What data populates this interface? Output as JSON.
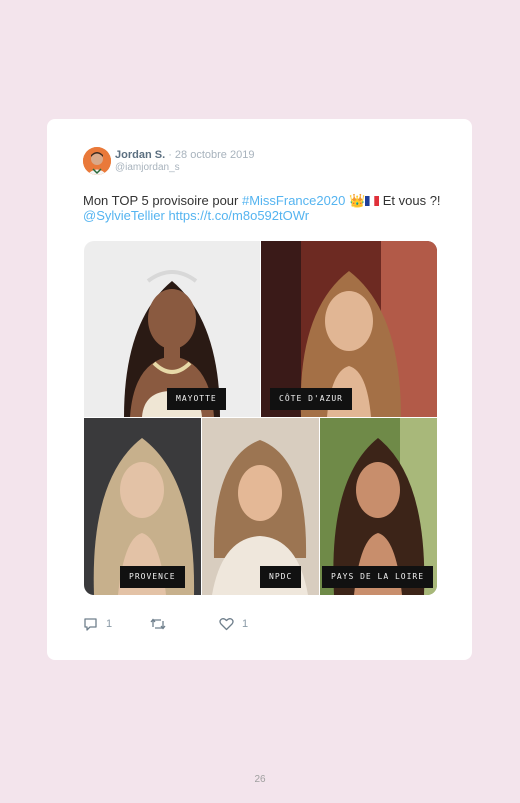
{
  "tweet": {
    "author_name": "Jordan S.",
    "separator": "·",
    "date": "28 octobre 2019",
    "handle": "@iamjordan_s",
    "text_plain": "Mon TOP 5 provisoire pour ",
    "hashtag": "#MissFrance2020",
    "crown_emoji": "👑",
    "text_after": " Et vous ?! ",
    "mention": "@SylvieTellier",
    "url": "https://t.co/m8o592tOWr"
  },
  "photos": [
    {
      "label": "MAYOTTE"
    },
    {
      "label": "CÔTE D'AZUR"
    },
    {
      "label": "PROVENCE"
    },
    {
      "label": "NPDC"
    },
    {
      "label": "PAYS DE LA LOIRE"
    }
  ],
  "actions": {
    "reply_count": "1",
    "retweet_count": "",
    "like_count": "1"
  },
  "page_number": "26",
  "colors": {
    "background": "#f3e4ec",
    "link": "#55b4f0",
    "name": "#5b6f80"
  },
  "icons": [
    "reply-icon",
    "retweet-icon",
    "heart-icon",
    "crown-icon",
    "france-flag-icon"
  ]
}
